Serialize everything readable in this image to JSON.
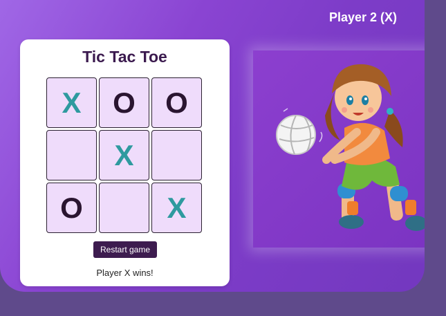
{
  "header": {
    "player_label": "Player 2 (X)"
  },
  "game": {
    "title": "Tic Tac Toe",
    "cells": [
      "X",
      "O",
      "O",
      "",
      "X",
      "",
      "O",
      "",
      "X"
    ],
    "restart_label": "Restart game",
    "status": "Player X wins!"
  },
  "colors": {
    "x_mark": "#2e9a9f",
    "o_mark": "#2a1530",
    "cell_bg": "#efdcfb",
    "button_bg": "#3d1c4f"
  },
  "illustration": {
    "subject": "girl-playing-volleyball"
  }
}
